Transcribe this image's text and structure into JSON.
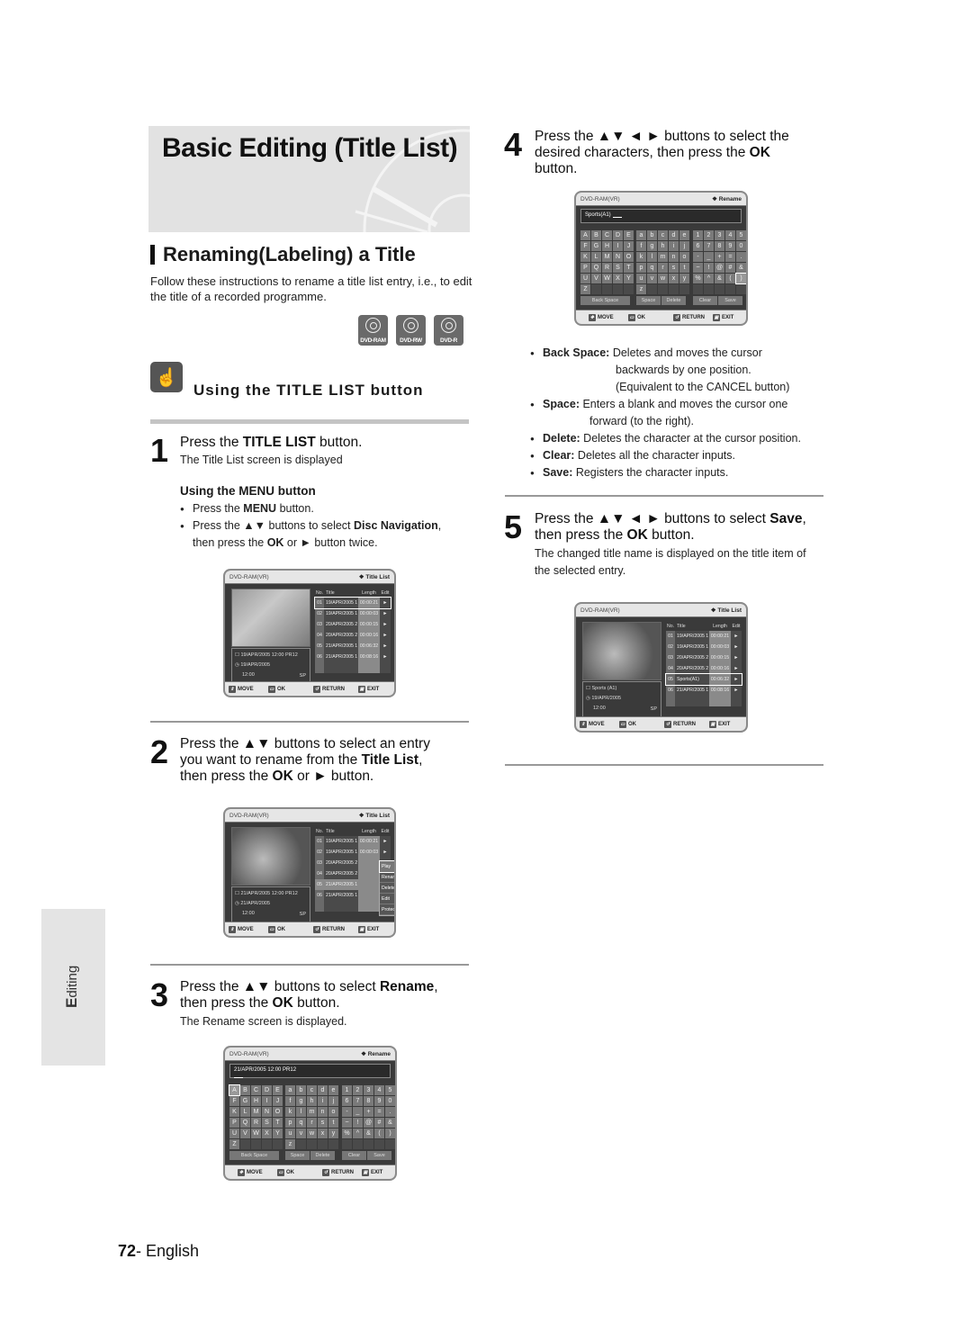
{
  "header": {
    "title": "Basic Editing (Title List)"
  },
  "section": {
    "title": "Renaming(Labeling) a Title",
    "intro": "Follow these instructions to rename a title list entry, i.e., to edit the title of a recorded programme."
  },
  "disc_badges": [
    "DVD-RAM",
    "DVD-RW",
    "DVD-R"
  ],
  "using": {
    "icon": "hand-pointer-icon",
    "title": "Using the TITLE LIST button"
  },
  "step1": {
    "num": "1",
    "main_pre": "Press the ",
    "main_bold": "TITLE LIST",
    "main_post": " button.",
    "sub": "The Title List screen is displayed",
    "menu_heading": "Using the MENU button",
    "bullets": [
      {
        "pre": "Press the ",
        "bold": "MENU",
        "post": " button."
      },
      {
        "pre": "Press the ▲▼ buttons to select ",
        "bold": "Disc Navigation",
        "post": ","
      },
      {
        "pre": "then press the ",
        "bold": "OK",
        "post": " or ► button twice."
      }
    ]
  },
  "step2": {
    "num": "2",
    "line1": "Press the ▲▼ buttons to select an entry",
    "line2_pre": "you want to rename from the ",
    "line2_bold": "Title List",
    "line2_post": ",",
    "line3_pre": "then press the ",
    "line3_bold": "OK",
    "line3_post": " or ► button."
  },
  "step3": {
    "num": "3",
    "line1_pre": "Press the ▲▼ buttons to select ",
    "line1_bold": "Rename",
    "line1_post": ",",
    "line2_pre": "then press the ",
    "line2_bold": "OK",
    "line2_post": " button.",
    "sub": "The Rename screen is displayed."
  },
  "step4": {
    "num": "4",
    "line1": "Press the ▲▼ ◄ ► buttons to select the",
    "line2_pre": "desired characters, then press the ",
    "line2_bold": "OK",
    "line3": "button.",
    "bullets": [
      {
        "bold": "Back Space:",
        "text": " Deletes and moves the cursor",
        "cont": [
          "backwards by one position.",
          "(Equivalent to the CANCEL button)"
        ]
      },
      {
        "bold": "Space:",
        "text": "  Enters a blank and moves the cursor one",
        "cont": [
          "forward (to the right)."
        ]
      },
      {
        "bold": "Delete:",
        "text": " Deletes the character at the cursor position.",
        "cont": []
      },
      {
        "bold": "Clear:",
        "text": " Deletes all the character inputs.",
        "cont": []
      },
      {
        "bold": "Save:",
        "text": " Registers the character inputs.",
        "cont": []
      }
    ]
  },
  "step5": {
    "num": "5",
    "line1_pre": "Press the ▲▼ ◄ ► buttons to select ",
    "line1_bold": "Save",
    "line1_post": ",",
    "line2_pre": "then press the ",
    "line2_bold": "OK",
    "line2_post": " button.",
    "sub": "The changed title name is displayed on the title item of the selected entry."
  },
  "screens": {
    "mode": "DVD-RAM(VR)",
    "title_list_label": "❖ Title List",
    "rename_label": "❖ Rename",
    "columns": {
      "no": "No.",
      "title": "Title",
      "length": "Length",
      "edit": "Edit"
    },
    "footer": {
      "move": "MOVE",
      "ok": "OK",
      "return": "RETURN",
      "exit": "EXIT"
    },
    "list1": {
      "rows": [
        {
          "no": "01",
          "title": "19/APR/2005 1",
          "length": "00:00:21",
          "edit": "►"
        },
        {
          "no": "02",
          "title": "19/APR/2005 1",
          "length": "00:00:03",
          "edit": "►"
        },
        {
          "no": "03",
          "title": "20/APR/2005 2",
          "length": "00:00:15",
          "edit": "►"
        },
        {
          "no": "04",
          "title": "20/APR/2005 2",
          "length": "00:00:16",
          "edit": "►"
        },
        {
          "no": "05",
          "title": "21/APR/2005 1",
          "length": "00:06:32",
          "edit": "►"
        },
        {
          "no": "06",
          "title": "21/APR/2005 1",
          "length": "00:08:16",
          "edit": "►"
        }
      ],
      "info": {
        "title": "19/APR/2005 12:00 PR12",
        "date": "19/APR/2005",
        "time": "12:00",
        "quality": "SP"
      }
    },
    "list2": {
      "rows": [
        {
          "no": "01",
          "title": "19/APR/2005 1",
          "length": "00:00:21",
          "edit": "►"
        },
        {
          "no": "02",
          "title": "19/APR/2005 1",
          "length": "00:00:03",
          "edit": "►"
        },
        {
          "no": "03",
          "title": "20/APR/2005 2",
          "length": "",
          "edit": ""
        },
        {
          "no": "04",
          "title": "20/APR/2005 2",
          "length": "",
          "edit": ""
        },
        {
          "no": "05",
          "title": "21/APR/2005 1",
          "length": "",
          "edit": ""
        },
        {
          "no": "06",
          "title": "21/APR/2005 1",
          "length": "",
          "edit": ""
        }
      ],
      "popup": [
        "Play",
        "Rename",
        "Delete",
        "Edit",
        "Protection"
      ],
      "info": {
        "title": "21/APR/2005 12:00 PR12",
        "date": "21/APR/2005",
        "time": "12:00",
        "quality": "SP"
      }
    },
    "rename1": {
      "value": "21/APR/2005 12:00 PR12"
    },
    "rename2": {
      "value": "Sports(A1)"
    },
    "keyboard": {
      "upper": [
        "A",
        "B",
        "C",
        "D",
        "E",
        "F",
        "G",
        "H",
        "I",
        "J",
        "K",
        "L",
        "M",
        "N",
        "O",
        "P",
        "Q",
        "R",
        "S",
        "T",
        "U",
        "V",
        "W",
        "X",
        "Y",
        "Z",
        "",
        "",
        "",
        ""
      ],
      "lower": [
        "a",
        "b",
        "c",
        "d",
        "e",
        "f",
        "g",
        "h",
        "i",
        "j",
        "k",
        "l",
        "m",
        "n",
        "o",
        "p",
        "q",
        "r",
        "s",
        "t",
        "u",
        "v",
        "w",
        "x",
        "y",
        "z",
        "",
        "",
        "",
        ""
      ],
      "symbols": [
        "1",
        "2",
        "3",
        "4",
        "5",
        "6",
        "7",
        "8",
        "9",
        "0",
        "-",
        "_",
        "+",
        "=",
        ".",
        "~",
        "!",
        "@",
        "#",
        "&",
        "%",
        "^",
        "&",
        "(",
        ")",
        "",
        "",
        "",
        "",
        ""
      ],
      "actions": [
        "Back Space",
        "Space",
        "Delete",
        "Clear",
        "Save"
      ]
    },
    "list3": {
      "rows": [
        {
          "no": "01",
          "title": "19/APR/2005 1",
          "length": "00:00:21",
          "edit": "►"
        },
        {
          "no": "02",
          "title": "19/APR/2005 1",
          "length": "00:00:03",
          "edit": "►"
        },
        {
          "no": "03",
          "title": "20/APR/2005 2",
          "length": "00:00:15",
          "edit": "►"
        },
        {
          "no": "04",
          "title": "20/APR/2005 2",
          "length": "00:00:16",
          "edit": "►"
        },
        {
          "no": "05",
          "title": "Sports(A1)",
          "length": "00:06:32",
          "edit": "►"
        },
        {
          "no": "06",
          "title": "21/APR/2005 1",
          "length": "00:08:16",
          "edit": "►"
        }
      ],
      "info": {
        "title": "Sports (A1)",
        "date": "19/APR/2005",
        "time": "12:00",
        "quality": "SP"
      }
    }
  },
  "side_tab": "Editing",
  "page": {
    "number": "72",
    "suffix": "- English"
  }
}
